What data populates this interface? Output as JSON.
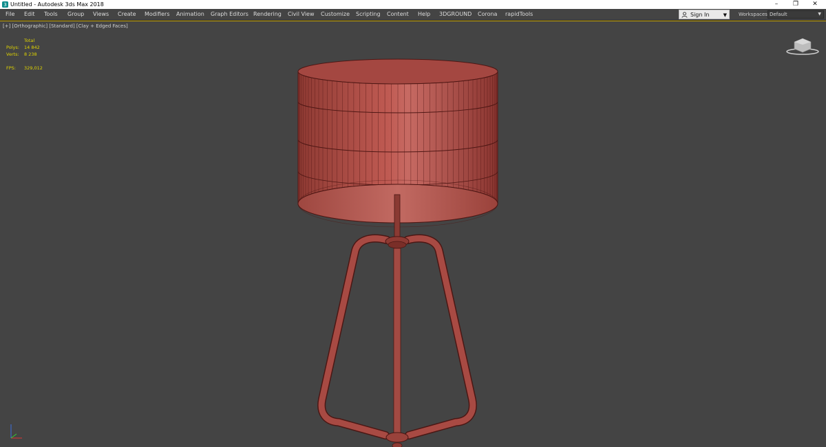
{
  "window": {
    "title": "Untitled - Autodesk 3ds Max 2018",
    "controls": [
      "–",
      "❐",
      "✕"
    ]
  },
  "menu": {
    "items": [
      "File",
      "Edit",
      "Tools",
      "Group",
      "Views",
      "Create",
      "Modifiers",
      "Animation",
      "Graph Editors",
      "Rendering",
      "Civil View",
      "Customize",
      "Scripting",
      "Content",
      "Help",
      "3DGROUND",
      "Corona",
      "rapidTools"
    ],
    "sign_in": "Sign In",
    "workspaces_label": "Workspaces:",
    "workspace_value": "Default"
  },
  "viewport": {
    "label": "[+] [Orthographic] [Standard] [Clay + Edged Faces]",
    "stats": {
      "header": "Total",
      "polys_label": "Polys:",
      "polys_value": "14 842",
      "verts_label": "Verts:",
      "verts_value": "8 238",
      "fps_label": "FPS:",
      "fps_value": "329,012"
    },
    "model_color": "#a94a42",
    "wire_color": "#5a1a18"
  },
  "icons": {
    "app": "3dsmax-logo-icon",
    "user": "user-icon",
    "viewcube": "viewcube-icon",
    "axis": "axis-tripod-icon"
  }
}
